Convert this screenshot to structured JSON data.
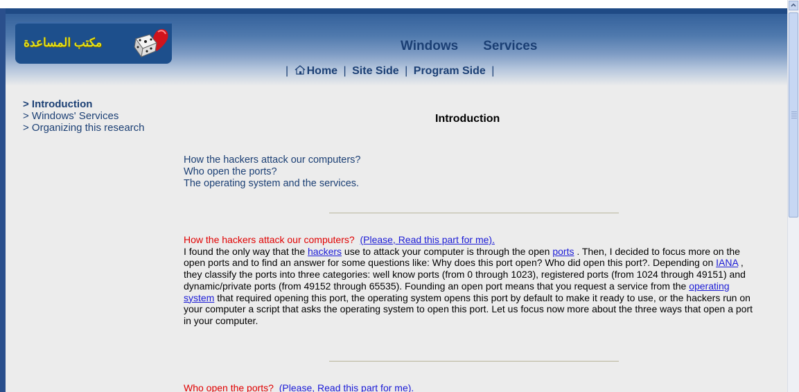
{
  "header": {
    "logo_text": "مكتب المساعدة",
    "title_words": [
      "Windows",
      "Services"
    ],
    "menu": {
      "home_label": "Home",
      "site_side_label": "Site Side",
      "program_side_label": "Program Side",
      "separator": "|"
    }
  },
  "sidebar": {
    "items": [
      {
        "label": "> Introduction"
      },
      {
        "label": "> Windows' Services"
      },
      {
        "label": "> Organizing this research"
      }
    ]
  },
  "content": {
    "title": "Introduction",
    "toc": [
      "How the hackers attack our computers?",
      "Who open the ports?",
      "The operating system and the services."
    ],
    "section1": {
      "heading": "How the hackers attack our computers?",
      "read_link": "(Please, Read this part for me).",
      "t1": "I found the only way that the ",
      "link_hackers": "hackers",
      "t2": " use to attack your computer is through the open ",
      "link_ports": "ports",
      "t3": " . Then, I decided to focus more on the open ports and to find an answer for some questions like: Why does this port open? Who did open this port?. Depending on ",
      "link_iana": "IANA",
      "t4": " , they classify the ports into three categories: well know ports (from 0 through 1023), registered ports (from 1024 through 49151) and dynamic/private ports (from 49152 through 65535). Founding an open port means that you request a service from the ",
      "link_os": "operating system",
      "t5": " that required opening this port, the operating system opens this port by default to make it ready to use, or the hackers run on your computer a script that asks the operating system to open this port. Let us focus now more about the three ways that open a port in your computer."
    },
    "section2": {
      "heading": "Who open the ports?",
      "read_link": "(Please, Read this part for me)."
    }
  },
  "colors": {
    "header_dark": "#2c5a96",
    "nav_text": "#1b3f74",
    "heading_red": "#e00000",
    "link_blue": "#1a1ad6",
    "page_bg": "#ececec"
  },
  "icons": [
    "logo-heart-dice-icon",
    "home-icon",
    "scroll-up-arrow-icon"
  ]
}
